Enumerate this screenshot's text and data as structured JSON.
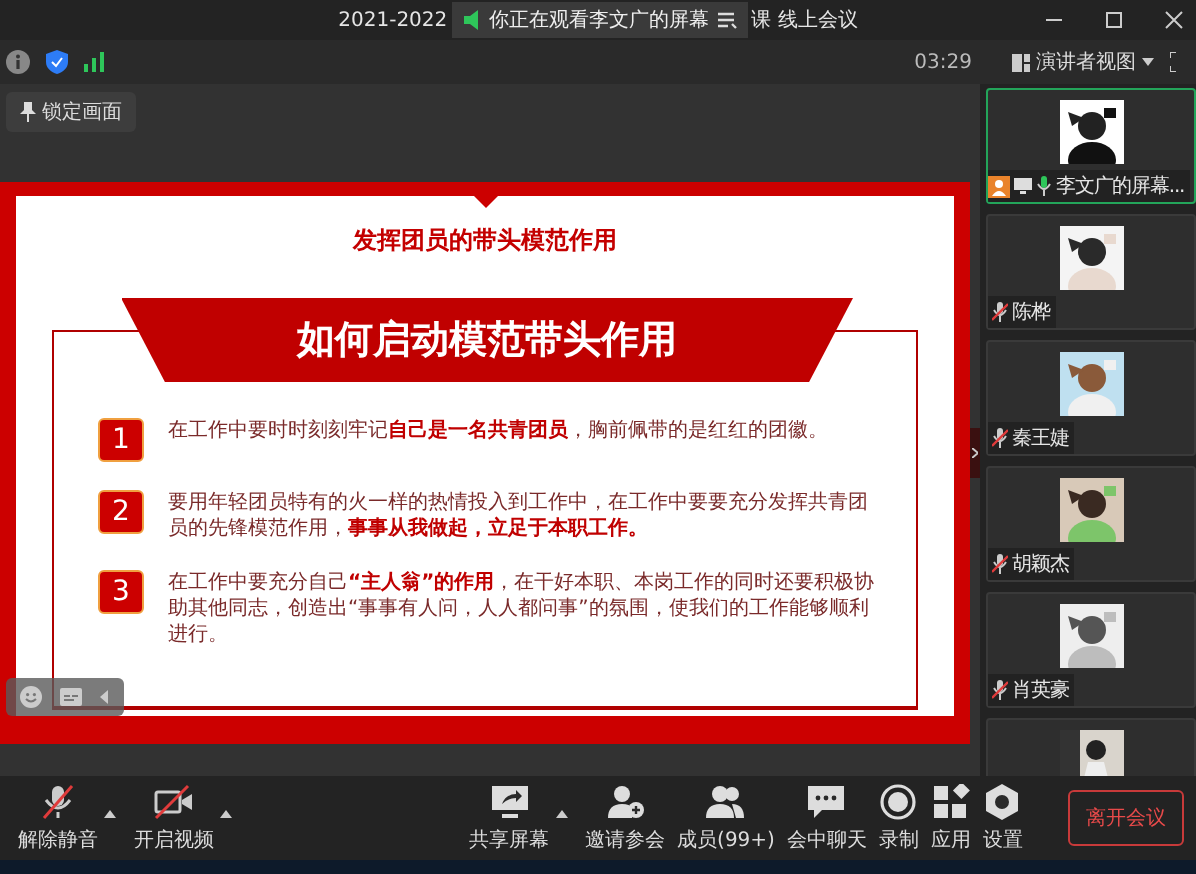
{
  "window": {
    "title_start": "2021-2022",
    "title_end": "课 线上会议"
  },
  "viewing_banner": "你正在观看李文广的屏幕",
  "toolbar": {
    "time": "03:29",
    "view_button": "演讲者视图"
  },
  "lock_button": "锁定画面",
  "slide": {
    "subtitle": "发挥团员的带头模范作用",
    "heading": "如何启动模范带头作用",
    "items": [
      {
        "number": "1",
        "text": "在工作中要时时刻刻牢记**自己是一名共青团员**，胸前佩带的是红红的团徽。"
      },
      {
        "number": "2",
        "text": "要用年轻团员特有的火一样的热情投入到工作中，在工作中要要充分发挥共青团员的先锋模范作用，**事事从我做起，立足于本职工作。**"
      },
      {
        "number": "3",
        "text": "在工作中要充分自己**“主人翁”的作用**，在干好本职、本岗工作的同时还要积极协助其他同志，创造出“事事有人问，人人都问事”的氛围，使我们的工作能够顺利进行。"
      }
    ]
  },
  "participants": [
    {
      "name": "李文广的屏幕...",
      "selected": true,
      "sharing": true,
      "muted": false
    },
    {
      "name": "陈桦",
      "selected": false,
      "sharing": false,
      "muted": true
    },
    {
      "name": "秦王婕",
      "selected": false,
      "sharing": false,
      "muted": true
    },
    {
      "name": "胡颖杰",
      "selected": false,
      "sharing": false,
      "muted": true
    },
    {
      "name": "肖英豪",
      "selected": false,
      "sharing": false,
      "muted": true
    }
  ],
  "controls": [
    {
      "kind": "mic_off",
      "label": "解除静音",
      "caret": true
    },
    {
      "kind": "video_off",
      "label": "开启视频",
      "caret": true
    },
    {
      "kind": "share",
      "label": "共享屏幕",
      "caret": true
    },
    {
      "kind": "invite",
      "label": "邀请参会",
      "caret": false
    },
    {
      "kind": "members",
      "label": "成员(99+)",
      "caret": false
    },
    {
      "kind": "chat",
      "label": "会中聊天",
      "caret": false
    },
    {
      "kind": "record",
      "label": "录制",
      "caret": false
    },
    {
      "kind": "apps",
      "label": "应用",
      "caret": false
    },
    {
      "kind": "settings",
      "label": "设置",
      "caret": false
    }
  ],
  "leave_button": "离开会议"
}
